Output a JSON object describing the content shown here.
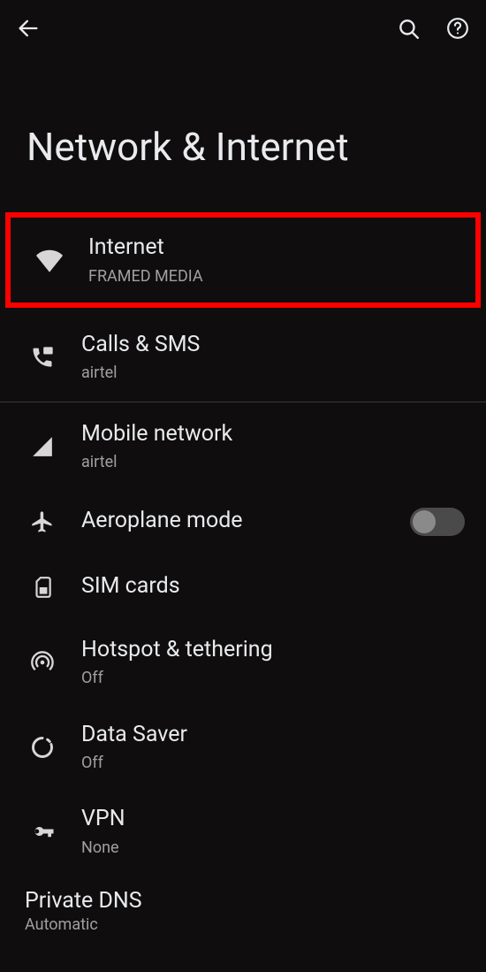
{
  "header": {
    "title": "Network & Internet"
  },
  "items": {
    "internet": {
      "title": "Internet",
      "sub": "FRAMED MEDIA"
    },
    "calls": {
      "title": "Calls & SMS",
      "sub": "airtel"
    },
    "mobile": {
      "title": "Mobile network",
      "sub": "airtel"
    },
    "aeroplane": {
      "title": "Aeroplane mode"
    },
    "sim": {
      "title": "SIM cards"
    },
    "hotspot": {
      "title": "Hotspot & tethering",
      "sub": "Off"
    },
    "datasaver": {
      "title": "Data Saver",
      "sub": "Off"
    },
    "vpn": {
      "title": "VPN",
      "sub": "None"
    },
    "privatedns": {
      "title": "Private DNS",
      "sub": "Automatic"
    }
  },
  "aeroplane_on": false
}
